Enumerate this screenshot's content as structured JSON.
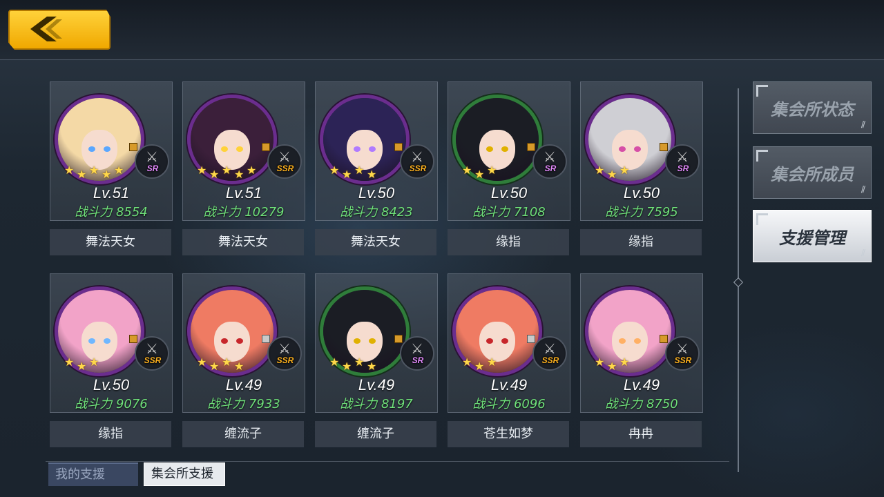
{
  "back_button": {
    "icon": "chevron-left-icon"
  },
  "members": [
    {
      "level": "Lv.51",
      "power_label": "战斗力",
      "power": "8554",
      "name": "舞法天女",
      "weapon_rarity": "SR",
      "hair": "#f4d9a6",
      "eyes": "#5aa7ff",
      "stars": 5
    },
    {
      "level": "Lv.51",
      "power_label": "战斗力",
      "power": "10279",
      "name": "舞法天女",
      "weapon_rarity": "SSR",
      "hair": "#3b1f3a",
      "eyes": "#ffd23a",
      "stars": 5
    },
    {
      "level": "Lv.50",
      "power_label": "战斗力",
      "power": "8423",
      "name": "舞法天女",
      "weapon_rarity": "SSR",
      "hair": "#2c2356",
      "eyes": "#b07bff",
      "stars": 4
    },
    {
      "level": "Lv.50",
      "power_label": "战斗力",
      "power": "7108",
      "name": "缘指",
      "weapon_rarity": "SR",
      "hair": "#1b1d24",
      "eyes": "#e0b100",
      "stars": 3
    },
    {
      "level": "Lv.50",
      "power_label": "战斗力",
      "power": "7595",
      "name": "缘指",
      "weapon_rarity": "SR",
      "hair": "#cfcfd4",
      "eyes": "#d64fa7",
      "stars": 3
    },
    {
      "level": "Lv.50",
      "power_label": "战斗力",
      "power": "9076",
      "name": "缘指",
      "weapon_rarity": "SSR",
      "hair": "#f2a3c8",
      "eyes": "#6fb7ff",
      "stars": 3
    },
    {
      "level": "Lv.49",
      "power_label": "战斗力",
      "power": "7933",
      "name": "缠流子",
      "weapon_rarity": "SSR",
      "hair": "#ef7b63",
      "eyes": "#c7262b",
      "stars": 4
    },
    {
      "level": "Lv.49",
      "power_label": "战斗力",
      "power": "8197",
      "name": "缠流子",
      "weapon_rarity": "SR",
      "hair": "#1b1d24",
      "eyes": "#e0b100",
      "stars": 4
    },
    {
      "level": "Lv.49",
      "power_label": "战斗力",
      "power": "6096",
      "name": "苍生如梦",
      "weapon_rarity": "SSR",
      "hair": "#ef7b63",
      "eyes": "#c7262b",
      "stars": 3
    },
    {
      "level": "Lv.49",
      "power_label": "战斗力",
      "power": "8750",
      "name": "冉冉",
      "weapon_rarity": "SSR",
      "hair": "#f2a3c8",
      "eyes": "#ffb064",
      "stars": 3
    }
  ],
  "side_menu": [
    {
      "label": "集会所状态",
      "active": false
    },
    {
      "label": "集会所成员",
      "active": false
    },
    {
      "label": "支援管理",
      "active": true
    }
  ],
  "bottom_tabs": [
    {
      "label": "我的支援",
      "active": false
    },
    {
      "label": "集会所支援",
      "active": true
    }
  ],
  "colors": {
    "accent": "#f0b400",
    "power": "#6fe07a",
    "frame_purple": "#6b2d8e",
    "frame_green": "#2f7d3a"
  }
}
